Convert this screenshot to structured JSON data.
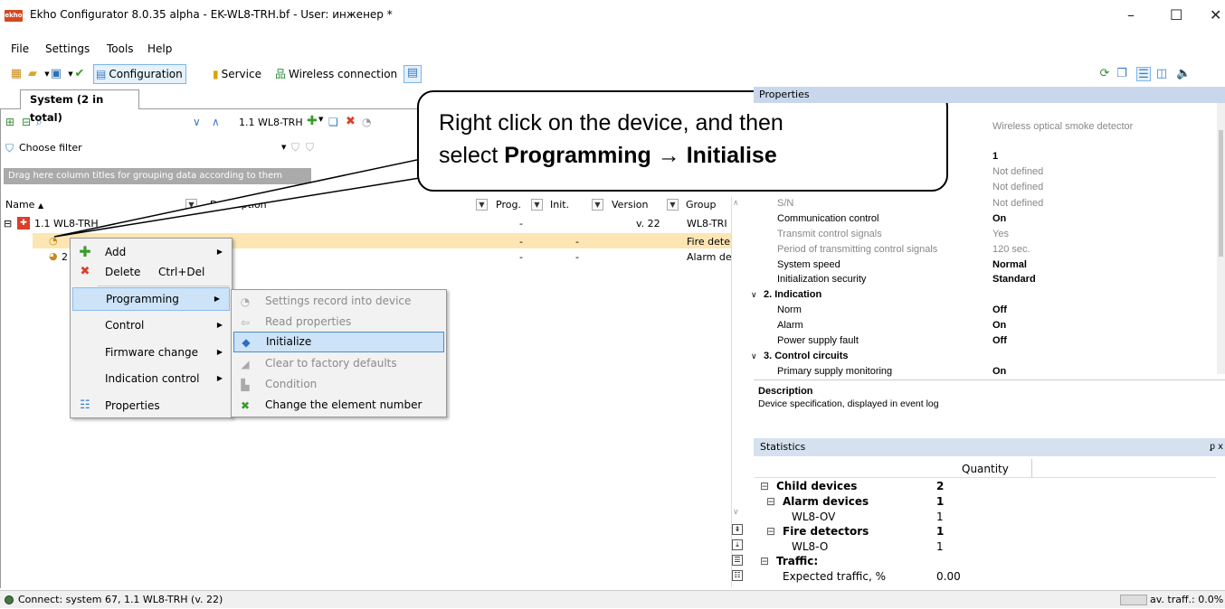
{
  "window": {
    "app_icon_text": "ekho",
    "title": "Ekho Configurator 8.0.35 alpha - EK-WL8-TRH.bf - User: инженер *",
    "minimize": "–",
    "maximize": "☐",
    "close": "✕"
  },
  "menu": [
    "File",
    "Settings",
    "Tools",
    "Help"
  ],
  "toolbar": {
    "configuration": "Configuration",
    "service": "Service",
    "wireless": "Wireless connection"
  },
  "tab": "System (2 in total)",
  "device_toolbar": {
    "device_label": "1.1 WL8-TRH",
    "filter_label": "Choose filter"
  },
  "group_hint": "Drag here column titles for grouping data according to them",
  "columns": {
    "name": "Name",
    "description": "Description",
    "prog": "Prog.",
    "init": "Init.",
    "version": "Version",
    "group": "Group"
  },
  "rows": [
    {
      "name": "1.1 WL8-TRH",
      "prog": "-",
      "init": "",
      "version": "v. 22",
      "group": "WL8-TRI"
    },
    {
      "name": "",
      "prog": "-",
      "init": "-",
      "version": "",
      "group": "Fire dete"
    },
    {
      "name": "2",
      "prog": "-",
      "init": "-",
      "version": "",
      "group": "Alarm de"
    }
  ],
  "context_menu": [
    {
      "label": "Add",
      "shortcut": "",
      "submenu": true
    },
    {
      "label": "Delete",
      "shortcut": "Ctrl+Del",
      "submenu": false
    },
    {
      "label": "Programming",
      "shortcut": "",
      "submenu": true
    },
    {
      "label": "Control",
      "shortcut": "",
      "submenu": true
    },
    {
      "label": "Firmware change",
      "shortcut": "",
      "submenu": true
    },
    {
      "label": "Indication control",
      "shortcut": "",
      "submenu": true
    },
    {
      "label": "Properties",
      "shortcut": "",
      "submenu": false
    }
  ],
  "submenu": [
    {
      "label": "Settings record into device",
      "enabled": false
    },
    {
      "label": "Read properties",
      "enabled": false
    },
    {
      "label": "Initialize",
      "enabled": true
    },
    {
      "label": "Clear to factory defaults",
      "enabled": false
    },
    {
      "label": "Condition",
      "enabled": false
    },
    {
      "label": "Change the element number",
      "enabled": true
    }
  ],
  "callout": {
    "line1": "Right click on the device, and then",
    "line2_pre": "select ",
    "line2_bold1": "Programming",
    "line2_arrow": " → ",
    "line2_bold2": "Initialise"
  },
  "properties": {
    "header": "Properties",
    "rows": [
      {
        "name": "",
        "value": "Wireless optical smoke detector",
        "style": "dim"
      },
      {
        "name": "",
        "value": "1",
        "style": "bold"
      },
      {
        "name": "",
        "value": "Not defined",
        "style": "dim"
      },
      {
        "name": "",
        "value": "Not defined",
        "style": "dim"
      },
      {
        "name": "S/N",
        "value": "Not defined",
        "style": "dim"
      },
      {
        "name": "Communication control",
        "value": "On",
        "style": "bold"
      },
      {
        "name": "Transmit control signals",
        "value": "Yes",
        "style": "dim"
      },
      {
        "name": "Period of transmitting control signals",
        "value": "120 sec.",
        "style": "dim"
      },
      {
        "name": "System speed",
        "value": "Normal",
        "style": "bold"
      },
      {
        "name": "Initialization security",
        "value": "Standard",
        "style": "bold"
      },
      {
        "name": "2. Indication",
        "value": "",
        "style": "section"
      },
      {
        "name": "Norm",
        "value": "Off",
        "style": "bold"
      },
      {
        "name": "Alarm",
        "value": "On",
        "style": "bold"
      },
      {
        "name": "Power supply fault",
        "value": "Off",
        "style": "bold"
      },
      {
        "name": "3. Control circuits",
        "value": "",
        "style": "section"
      },
      {
        "name": "Primary supply monitoring",
        "value": "On",
        "style": "bold"
      }
    ]
  },
  "description": {
    "title": "Description",
    "text": "Device specification, displayed in event log"
  },
  "statistics": {
    "header": "Statistics",
    "pin": "ᵱ x",
    "quantity_header": "Quantity",
    "rows": [
      {
        "label": "Child devices",
        "qty": "2",
        "level": 0,
        "bold": true,
        "toggle": "⊟"
      },
      {
        "label": "Alarm devices",
        "qty": "1",
        "level": 1,
        "bold": true,
        "toggle": "⊟"
      },
      {
        "label": "WL8-OV",
        "qty": "1",
        "level": 2,
        "bold": false,
        "toggle": ""
      },
      {
        "label": "Fire detectors",
        "qty": "1",
        "level": 1,
        "bold": true,
        "toggle": "⊟"
      },
      {
        "label": "WL8-O",
        "qty": "1",
        "level": 2,
        "bold": false,
        "toggle": ""
      },
      {
        "label": "Traffic:",
        "qty": "",
        "level": 0,
        "bold": true,
        "toggle": "⊟"
      },
      {
        "label": "Expected traffic, %",
        "qty": "0.00",
        "level": 1,
        "bold": false,
        "toggle": ""
      }
    ]
  },
  "status": {
    "connect": "Connect: system 67, 1.1 WL8-TRH (v. 22)",
    "traffic": "av. traff.: 0.0%"
  }
}
